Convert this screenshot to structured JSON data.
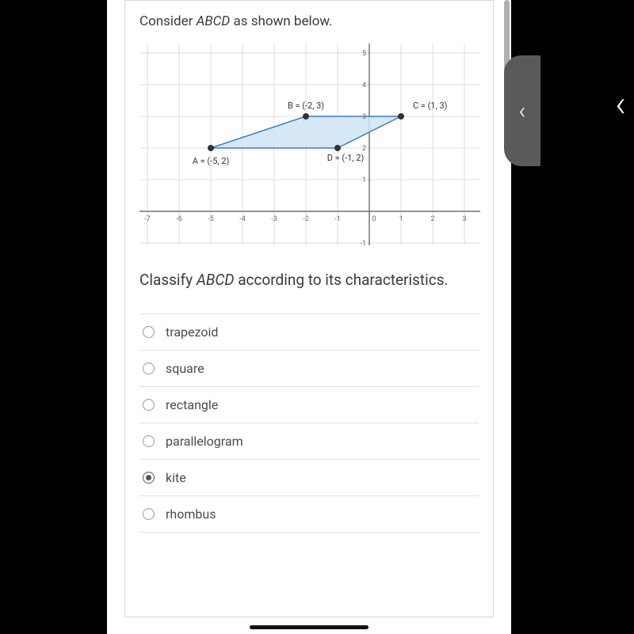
{
  "intro_prefix": "Consider ",
  "intro_shape": "ABCD",
  "intro_suffix": " as shown below.",
  "graph": {
    "points": {
      "A": {
        "x": -5,
        "y": 2,
        "label": "A = (-5, 2)"
      },
      "B": {
        "x": -2,
        "y": 3,
        "label": "B = (-2, 3)"
      },
      "C": {
        "x": 1,
        "y": 3,
        "label": "C = (1, 3)"
      },
      "D": {
        "x": -1,
        "y": 2,
        "label": "D = (-1, 2)"
      }
    },
    "x_ticks": [
      "-7",
      "-6",
      "-5",
      "-4",
      "-3",
      "-2",
      "-1",
      "0",
      "1",
      "2",
      "3"
    ],
    "y_ticks": [
      "-1",
      "1",
      "2",
      "3",
      "4",
      "5"
    ]
  },
  "classify_prefix": "Classify ",
  "classify_shape": "ABCD",
  "classify_suffix": " according to its characteristics.",
  "options": [
    {
      "id": "trapezoid",
      "label": "trapezoid",
      "selected": false
    },
    {
      "id": "square",
      "label": "square",
      "selected": false
    },
    {
      "id": "rectangle",
      "label": "rectangle",
      "selected": false
    },
    {
      "id": "parallelogram",
      "label": "parallelogram",
      "selected": false
    },
    {
      "id": "kite",
      "label": "kite",
      "selected": true
    },
    {
      "id": "rhombus",
      "label": "rhombus",
      "selected": false
    }
  ],
  "chevron": "‹"
}
